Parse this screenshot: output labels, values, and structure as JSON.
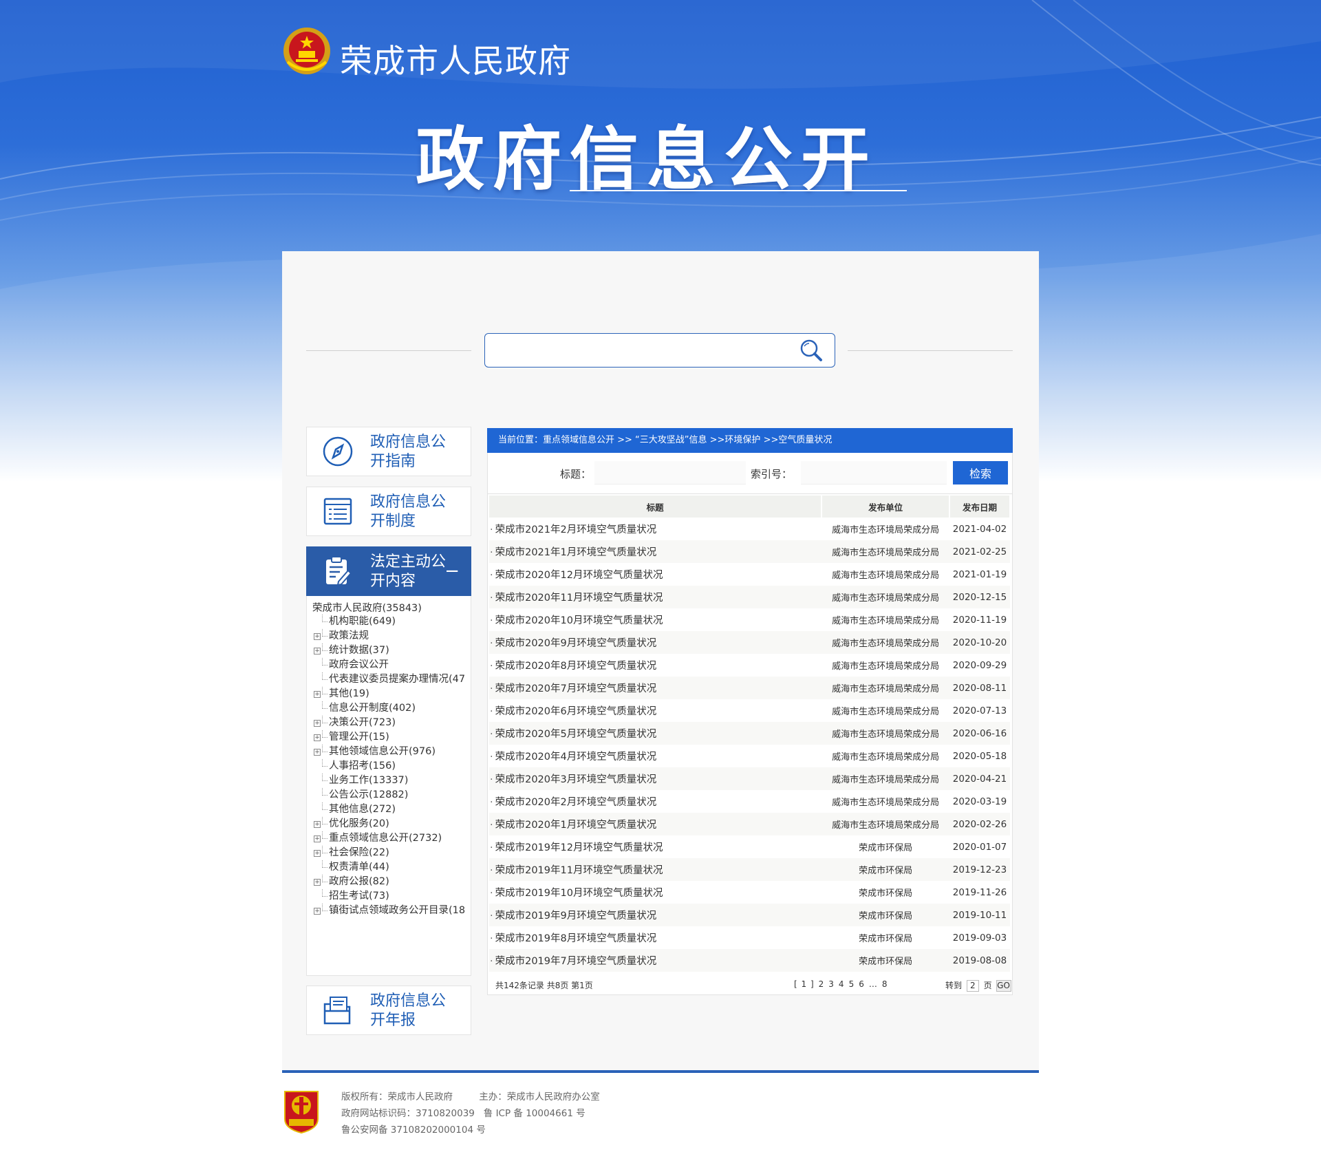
{
  "header": {
    "site_name": "荣成市人民政府",
    "title": "政府信息公开"
  },
  "search": {
    "placeholder": ""
  },
  "sidebar": {
    "cards": [
      {
        "label": "政府信息公开指南"
      },
      {
        "label": "政府信息公开制度"
      },
      {
        "label": "法定主动公开内容",
        "toggle": "−"
      },
      {
        "label": "政府信息公开年报"
      }
    ],
    "tree_root": "荣成市人民政府(35843)",
    "tree_items": [
      {
        "label": "机构职能(649)",
        "expand": false
      },
      {
        "label": "政策法规",
        "expand": true
      },
      {
        "label": "统计数据(37)",
        "expand": true
      },
      {
        "label": "政府会议公开",
        "expand": false
      },
      {
        "label": "代表建议委员提案办理情况(47",
        "expand": false
      },
      {
        "label": "其他(19)",
        "expand": true
      },
      {
        "label": "信息公开制度(402)",
        "expand": false
      },
      {
        "label": "决策公开(723)",
        "expand": true
      },
      {
        "label": "管理公开(15)",
        "expand": true
      },
      {
        "label": "其他领域信息公开(976)",
        "expand": true
      },
      {
        "label": "人事招考(156)",
        "expand": false
      },
      {
        "label": "业务工作(13337)",
        "expand": false
      },
      {
        "label": "公告公示(12882)",
        "expand": false
      },
      {
        "label": "其他信息(272)",
        "expand": false
      },
      {
        "label": "优化服务(20)",
        "expand": true
      },
      {
        "label": "重点领域信息公开(2732)",
        "expand": true
      },
      {
        "label": "社会保险(22)",
        "expand": true
      },
      {
        "label": "权责清单(44)",
        "expand": false
      },
      {
        "label": "政府公报(82)",
        "expand": true
      },
      {
        "label": "招生考试(73)",
        "expand": false
      },
      {
        "label": "镇街试点领域政务公开目录(18",
        "expand": true
      }
    ]
  },
  "breadcrumb": "当前位置：重点领域信息公开 >> “三大攻坚战”信息 >>环境保护 >>空气质量状况",
  "filter": {
    "title_label": "标题：",
    "index_label": "索引号：",
    "search_button": "检索"
  },
  "table": {
    "headers": [
      "标题",
      "发布单位",
      "发布日期"
    ],
    "rows": [
      [
        "荣成市2021年2月环境空气质量状况",
        "威海市生态环境局荣成分局",
        "2021-04-02"
      ],
      [
        "荣成市2021年1月环境空气质量状况",
        "威海市生态环境局荣成分局",
        "2021-02-25"
      ],
      [
        "荣成市2020年12月环境空气质量状况",
        "威海市生态环境局荣成分局",
        "2021-01-19"
      ],
      [
        "荣成市2020年11月环境空气质量状况",
        "威海市生态环境局荣成分局",
        "2020-12-15"
      ],
      [
        "荣成市2020年10月环境空气质量状况",
        "威海市生态环境局荣成分局",
        "2020-11-19"
      ],
      [
        "荣成市2020年9月环境空气质量状况",
        "威海市生态环境局荣成分局",
        "2020-10-20"
      ],
      [
        "荣成市2020年8月环境空气质量状况",
        "威海市生态环境局荣成分局",
        "2020-09-29"
      ],
      [
        "荣成市2020年7月环境空气质量状况",
        "威海市生态环境局荣成分局",
        "2020-08-11"
      ],
      [
        "荣成市2020年6月环境空气质量状况",
        "威海市生态环境局荣成分局",
        "2020-07-13"
      ],
      [
        "荣成市2020年5月环境空气质量状况",
        "威海市生态环境局荣成分局",
        "2020-06-16"
      ],
      [
        "荣成市2020年4月环境空气质量状况",
        "威海市生态环境局荣成分局",
        "2020-05-18"
      ],
      [
        "荣成市2020年3月环境空气质量状况",
        "威海市生态环境局荣成分局",
        "2020-04-21"
      ],
      [
        "荣成市2020年2月环境空气质量状况",
        "威海市生态环境局荣成分局",
        "2020-03-19"
      ],
      [
        "荣成市2020年1月环境空气质量状况",
        "威海市生态环境局荣成分局",
        "2020-02-26"
      ],
      [
        "荣成市2019年12月环境空气质量状况",
        "荣成市环保局",
        "2020-01-07"
      ],
      [
        "荣成市2019年11月环境空气质量状况",
        "荣成市环保局",
        "2019-12-23"
      ],
      [
        "荣成市2019年10月环境空气质量状况",
        "荣成市环保局",
        "2019-11-26"
      ],
      [
        "荣成市2019年9月环境空气质量状况",
        "荣成市环保局",
        "2019-10-11"
      ],
      [
        "荣成市2019年8月环境空气质量状况",
        "荣成市环保局",
        "2019-09-03"
      ],
      [
        "荣成市2019年7月环境空气质量状况",
        "荣成市环保局",
        "2019-08-08"
      ]
    ]
  },
  "pager": {
    "total": "共142条记录  共8页  第1页",
    "pages": [
      "[ 1 ]",
      "2",
      "3",
      "4",
      "5",
      "6",
      "…",
      "8"
    ],
    "goto_label": "转到",
    "goto_value": "2",
    "page_unit": "页",
    "go_button": "GO"
  },
  "footer": {
    "copyright": "版权所有：荣成市人民政府",
    "sponsor": "主办：荣成市人民政府办公室",
    "site_code": "政府网站标识码：3710820039",
    "icp": "鲁 ICP 备 10004661 号",
    "police": "鲁公安网备 37108202000104 号",
    "emblem_text": "党政机关"
  },
  "colors": {
    "primary": "#1f66d4",
    "nav_active": "#2a5ca8",
    "link_blue": "#1f5eb5"
  }
}
